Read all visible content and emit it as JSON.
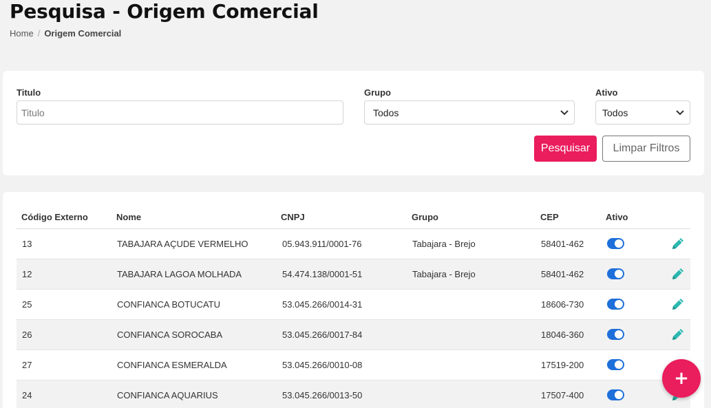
{
  "header": {
    "title": "Pesquisa - Origem Comercial",
    "breadcrumb": {
      "home": "Home",
      "separator": "/",
      "current": "Origem Comercial"
    }
  },
  "filters": {
    "titulo": {
      "label": "Titulo",
      "placeholder": "Titulo",
      "value": ""
    },
    "grupo": {
      "label": "Grupo",
      "selected": "Todos"
    },
    "ativo": {
      "label": "Ativo",
      "selected": "Todos"
    },
    "search_label": "Pesquisar",
    "clear_label": "Limpar Filtros"
  },
  "table": {
    "columns": [
      "Código Externo",
      "Nome",
      "CNPJ",
      "Grupo",
      "CEP",
      "Ativo"
    ],
    "rows": [
      {
        "codigo": "13",
        "nome": "TABAJARA AÇUDE VERMELHO",
        "cnpj": "05.943.911/0001-76",
        "grupo": "Tabajara - Brejo",
        "cep": "58401-462",
        "ativo": true
      },
      {
        "codigo": "12",
        "nome": "TABAJARA LAGOA MOLHADA",
        "cnpj": "54.474.138/0001-51",
        "grupo": "Tabajara - Brejo",
        "cep": "58401-462",
        "ativo": true
      },
      {
        "codigo": "25",
        "nome": "CONFIANCA BOTUCATU",
        "cnpj": "53.045.266/0014-31",
        "grupo": "",
        "cep": "18606-730",
        "ativo": true
      },
      {
        "codigo": "26",
        "nome": "CONFIANCA SOROCABA",
        "cnpj": "53.045.266/0017-84",
        "grupo": "",
        "cep": "18046-360",
        "ativo": true
      },
      {
        "codigo": "27",
        "nome": "CONFIANCA ESMERALDA",
        "cnpj": "53.045.266/0010-08",
        "grupo": "",
        "cep": "17519-200",
        "ativo": true
      },
      {
        "codigo": "24",
        "nome": "CONFIANCA AQUARIUS",
        "cnpj": "53.045.266/0013-50",
        "grupo": "",
        "cep": "17507-400",
        "ativo": true
      }
    ]
  },
  "fab": {
    "label": "+",
    "icon": "plus-icon"
  },
  "colors": {
    "accent": "#ea1d5d",
    "toggle": "#1e6fd9",
    "edit_icon": "#2bb8b0"
  },
  "icons": {
    "edit": "pencil-icon",
    "select": "chevron-down-icon"
  }
}
